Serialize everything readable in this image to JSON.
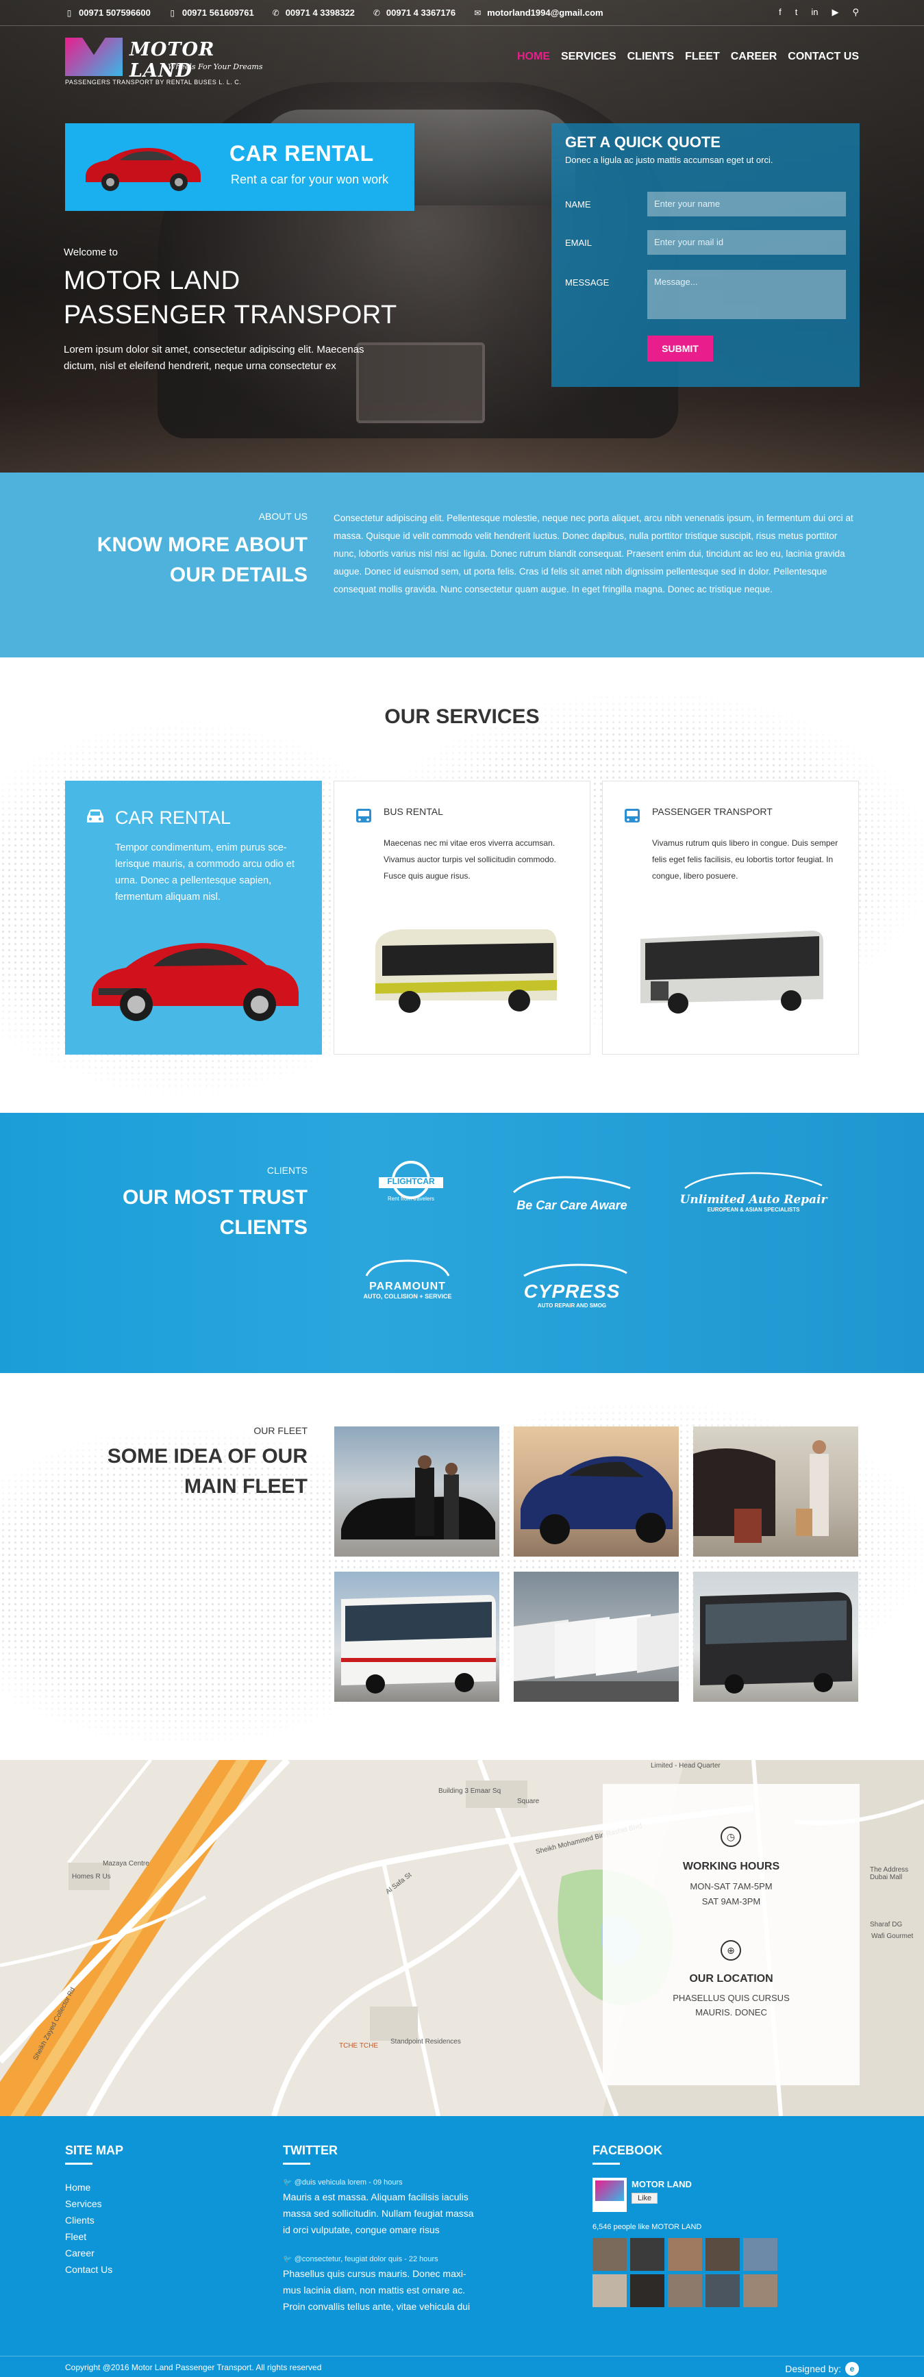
{
  "topbar": {
    "phones": [
      "00971 507596600",
      "00971 561609761",
      "00971 4 3398322",
      "00971 4 3367176"
    ],
    "email": "motorland1994@gmail.com",
    "social_icons": [
      "facebook-icon",
      "twitter-icon",
      "linkedin-icon",
      "youtube-icon",
      "search-icon"
    ]
  },
  "logo": {
    "name": "MOTOR LAND",
    "tagline": "Wheels For Your Dreams",
    "subline": "PASSENGERS TRANSPORT BY RENTAL BUSES L. L. C."
  },
  "nav": {
    "items": [
      "HOME",
      "SERVICES",
      "CLIENTS",
      "FLEET",
      "CAREER",
      "CONTACT US"
    ],
    "active": "HOME"
  },
  "hero": {
    "promo_title": "CAR RENTAL",
    "promo_subtitle": "Rent a car for your won work",
    "welcome": "Welcome to",
    "title_line1": "MOTOR LAND",
    "title_line2": "PASSENGER TRANSPORT",
    "text": "Lorem ipsum dolor sit amet, consectetur adipiscing elit. Maecenas dictum, nisl et eleifend hendrerit, neque urna consectetur ex"
  },
  "quote_form": {
    "title": "GET A QUICK QUOTE",
    "subtitle": "Donec a ligula ac justo mattis accumsan eget ut orci.",
    "name_label": "NAME",
    "name_placeholder": "Enter your name",
    "email_label": "EMAIL",
    "email_placeholder": "Enter your mail id",
    "message_label": "MESSAGE",
    "message_placeholder": "Message...",
    "submit_label": "SUBMIT"
  },
  "about": {
    "label": "ABOUT US",
    "title_line1": "KNOW MORE  ABOUT",
    "title_line2": "OUR DETAILS",
    "text": "Consectetur adipiscing elit. Pellentesque molestie, neque nec porta aliquet, arcu nibh venenatis ipsum, in fermentum dui orci at massa. Quisque id velit commodo velit hendrerit luctus. Donec dapibus, nulla porttitor tristique suscipit, risus metus porttitor nunc, lobortis varius nisl nisi ac ligula. Donec rutrum blandit consequat. Praesent enim dui, tincidunt ac leo eu, lacinia gravida augue. Donec id euismod sem, ut porta felis. Cras id felis sit amet nibh dignissim pellentesque sed in dolor. Pellentesque consequat mollis gravida. Nunc consectetur quam augue. In eget fringilla magna. Donec ac tristique neque."
  },
  "services": {
    "title": "OUR SERVICES",
    "cards": [
      {
        "title": "CAR RENTAL",
        "text": "Tempor condimentum, enim purus sce-lerisque mauris, a commodo arcu odio et urna. Donec a pellentesque sapien, fermentum aliquam nisl."
      },
      {
        "title": "BUS RENTAL",
        "text": "Maecenas nec mi vitae eros viverra accumsan. Vivamus auctor turpis vel sollicitudin commodo. Fusce quis augue risus."
      },
      {
        "title": "PASSENGER TRANSPORT",
        "text": "Vivamus rutrum quis libero in congue. Duis semper felis eget felis facilisis, eu lobortis tortor feugiat. In congue, libero posuere."
      }
    ]
  },
  "clients": {
    "label": "CLIENTS",
    "title_line1": "OUR MOST TRUST",
    "title_line2": "CLIENTS",
    "logos": [
      "FLIGHTCAR",
      "Be Car Care Aware",
      "Unlimited Auto Repair",
      "PARAMOUNT",
      "CYPRESS"
    ],
    "logo_sublines": [
      "Rent from travelers",
      "EUROPEAN & ASIAN SPECIALISTS",
      "AUTO, COLLISION + SERVICE",
      "AUTO REPAIR AND SMOG"
    ]
  },
  "fleet": {
    "label": "OUR FLEET",
    "title_line1": "SOME IDEA OF OUR",
    "title_line2": "MAIN FLEET"
  },
  "map": {
    "hours_title": "WORKING HOURS",
    "hours_1": "MON-SAT 7AM-5PM",
    "hours_2": "SAT 9AM-3PM",
    "location_title": "OUR LOCATION",
    "location_1": "PHASELLUS QUIS CURSUS",
    "location_2": "MAURIS. DONEC",
    "labels": [
      "Building 3 Emaar Sq",
      "Limited - Head Quarter",
      "Mazaya Centre",
      "Homes R Us",
      "Standpoint Residences",
      "TCHE TCHE",
      "Al Safa St",
      "Sheikh Zayed Collector Rd",
      "Sheikh Mohammed Bin Rashid Blvd",
      "The Address Dubai Mall",
      "Sharaf DG",
      "Wafi Gourmet",
      "Square"
    ]
  },
  "footer": {
    "sitemap_title": "SITE MAP",
    "sitemap_links": [
      "Home",
      "Services",
      "Clients",
      "Fleet",
      "Career",
      "Contact Us"
    ],
    "twitter_title": "TWITTER",
    "tweets": [
      {
        "meta": "@duis vehicula lorem - 09 hours",
        "text": "Mauris a est massa. Aliquam facilisis iaculis massa sed sollicitudin. Nullam feugiat massa id orci vulputate, congue omare risus"
      },
      {
        "meta": "@consectetur, feugiat dolor quis - 22 hours",
        "text": "Phasellus quis cursus mauris. Donec maxi-mus lacinia diam, non mattis est ornare ac. Proin convallis tellus ante, vitae vehicula dui"
      }
    ],
    "facebook_title": "FACEBOOK",
    "fb_page": "MOTOR LAND",
    "fb_like": "Like",
    "fb_count": "6,546 people like MOTOR LAND",
    "copyright": "Copyright @2016  Motor Land Passenger Transport. All rights reserved",
    "designed_by": "Designed by:"
  },
  "colors": {
    "accent_pink": "#e91e8c",
    "brand_blue": "#1ab0ef",
    "footer_blue": "#0e95d7"
  }
}
